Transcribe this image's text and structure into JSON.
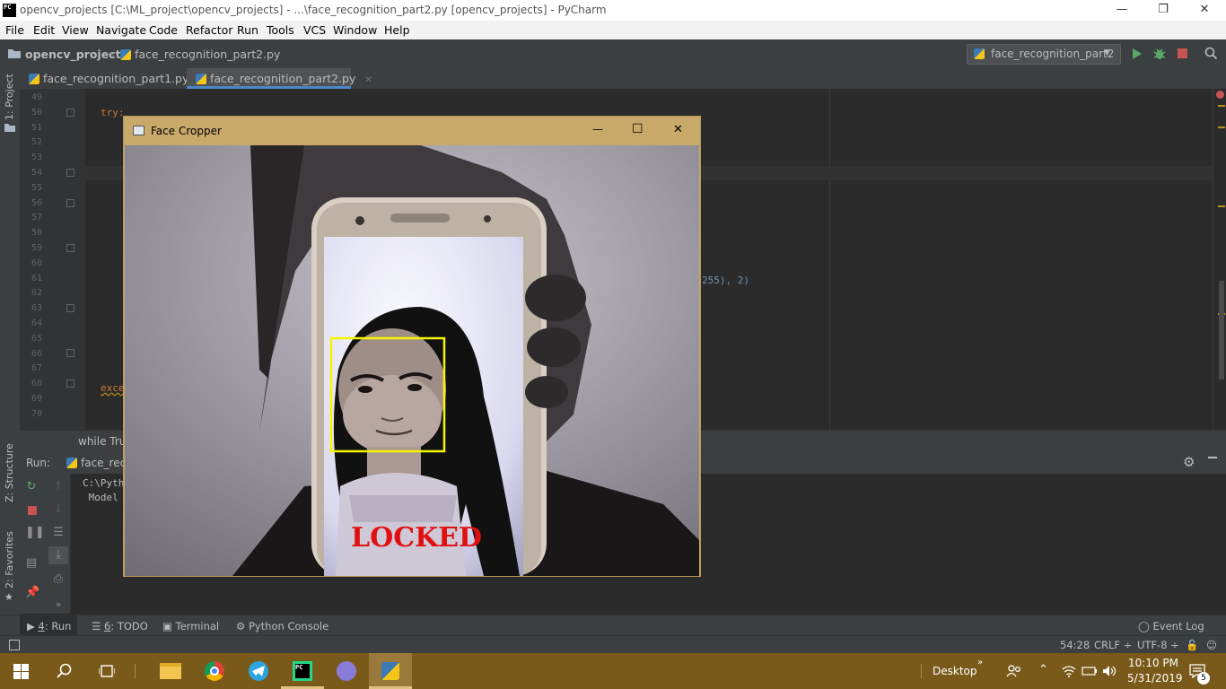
{
  "window_title": "opencv_projects [C:\\ML_project\\opencv_projects] - ...\\face_recognition_part2.py [opencv_projects] - PyCharm",
  "app_logo": "PC",
  "window_controls": {
    "minimize": "—",
    "maximize": "❐",
    "close": "✕"
  },
  "menu": [
    "File",
    "Edit",
    "View",
    "Navigate",
    "Code",
    "Refactor",
    "Run",
    "Tools",
    "VCS",
    "Window",
    "Help"
  ],
  "nav": {
    "project": "opencv_projects",
    "file": "face_recognition_part2.py",
    "sep": "›"
  },
  "run_config": {
    "name": "face_recognition_part2",
    "arrow": "▼"
  },
  "toolbar_icons": [
    "run-icon",
    "debug-icon",
    "stop-icon",
    "search-icon"
  ],
  "left_tabs": {
    "project": "1: Project",
    "structure": "Z: Structure",
    "favorites": "2: Favorites"
  },
  "tabs": [
    {
      "label": "face_recognition_part1.py",
      "close": "✕"
    },
    {
      "label": "face_recognition_part2.py",
      "close": "✕"
    }
  ],
  "line_numbers": [
    "49",
    "50",
    "51",
    "52",
    "53",
    "54",
    "55",
    "56",
    "57",
    "58",
    "59",
    "60",
    "61",
    "62",
    "63",
    "64",
    "65",
    "66",
    "67",
    "68",
    "69",
    "70"
  ],
  "code": {
    "try": "try:",
    "line61_tail": "255), 2)",
    "except": "exce",
    "line61_paren": "("
  },
  "breadcrumb": "while True",
  "run_panel": {
    "label": "Run:",
    "tab": "face_rec",
    "output": [
      "C:\\Pyth",
      " Model"
    ]
  },
  "face_cropper": {
    "title": "Face Cropper",
    "overlay_text": "LOCKED",
    "controls": {
      "minimize": "—",
      "maximize": "☐",
      "close": "✕"
    }
  },
  "tool_tabs": [
    {
      "num": "4",
      "label": ": Run"
    },
    {
      "num": "6",
      "label": ": TODO"
    },
    {
      "num": "",
      "label": "Terminal"
    },
    {
      "num": "",
      "label": "Python Console"
    }
  ],
  "event_log": "Event Log",
  "status": {
    "position": "54:28",
    "line_sep": "CRLF ÷",
    "encoding": "UTF-8 ÷"
  },
  "taskbar": {
    "desktop": "Desktop",
    "time": "10:10 PM",
    "date": "5/31/2019",
    "notifications": "5",
    "chevron": "»"
  }
}
